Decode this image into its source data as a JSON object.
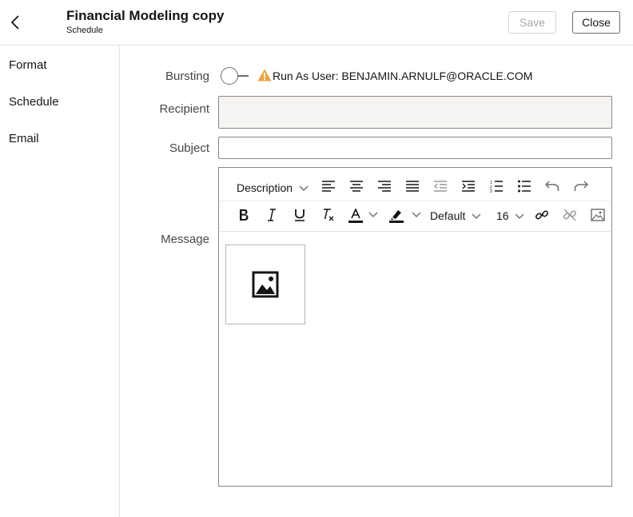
{
  "header": {
    "title": "Financial Modeling copy",
    "subtitle": "Schedule",
    "save_label": "Save",
    "close_label": "Close"
  },
  "sidebar": {
    "items": [
      {
        "label": "Format"
      },
      {
        "label": "Schedule"
      },
      {
        "label": "Email"
      }
    ]
  },
  "form": {
    "bursting_label": "Bursting",
    "bursting_on": false,
    "run_as_text": "Run As User: BENJAMIN.ARNULF@ORACLE.COM",
    "recipient_label": "Recipient",
    "recipient_value": "",
    "subject_label": "Subject",
    "subject_value": "",
    "message_label": "Message"
  },
  "editor_toolbar": {
    "paragraph_style": "Description",
    "font_family": "Default",
    "font_size": "16",
    "icons": [
      "align-left-icon",
      "align-center-icon",
      "align-right-icon",
      "justify-icon",
      "outdent-icon",
      "indent-icon",
      "numbered-list-icon",
      "bullet-list-icon",
      "undo-icon",
      "redo-icon",
      "bold-icon",
      "italic-icon",
      "underline-icon",
      "clear-format-icon",
      "font-color-icon",
      "highlight-color-icon",
      "link-icon",
      "unlink-icon",
      "insert-image-icon"
    ]
  },
  "colors": {
    "warning": "#e8a33b",
    "border": "#8b8784",
    "recipient_bg": "#f5f4f2"
  }
}
